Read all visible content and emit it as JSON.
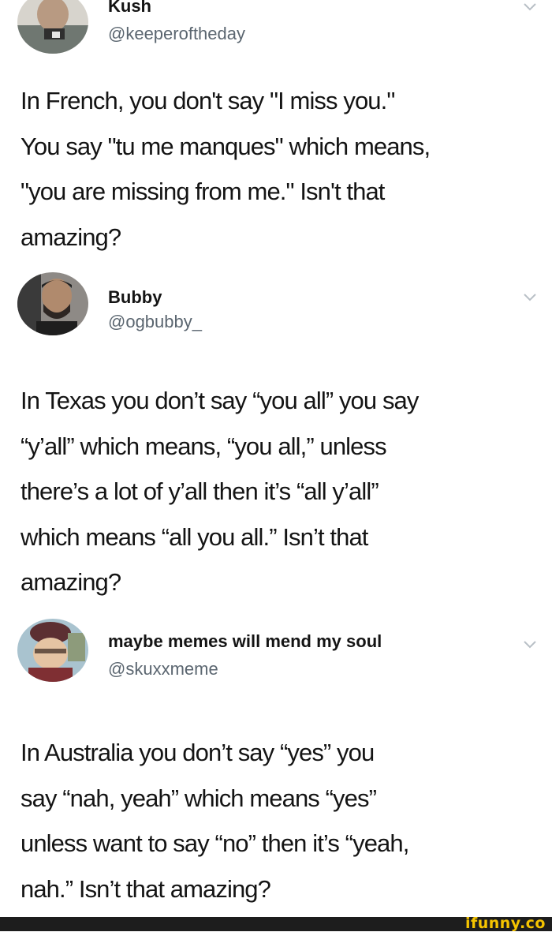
{
  "tweets": [
    {
      "display_name": "Kush",
      "handle": "@keeperoftheday",
      "text": "In French, you don't say \"I miss you.\"\nYou say \"tu me manques\" which means,\n\"you are missing from me.\" Isn't that\namazing?"
    },
    {
      "display_name": "Bubby",
      "handle": "@ogbubby_",
      "text": "In Texas you don’t say “you all” you say\n“y’all” which means, “you all,” unless\nthere’s a lot of y’all then it’s “all y’all”\nwhich means “all you all.” Isn’t that\namazing?"
    },
    {
      "display_name": "maybe memes will mend my soul",
      "handle": "@skuxxmeme",
      "text": "In Australia you don’t say “yes” you\nsay “nah, yeah” which means “yes”\nunless want to say “no” then it’s “yeah,\nnah.” Isn’t that amazing?"
    }
  ],
  "watermark": "ifunny.co",
  "colors": {
    "text": "#141414",
    "handle": "#5b6670",
    "chevron": "#b8bfc6",
    "watermark_bar": "#1d1d1d",
    "watermark_text": "#f5c400"
  },
  "icons": {
    "chevron": "chevron-down-icon"
  }
}
